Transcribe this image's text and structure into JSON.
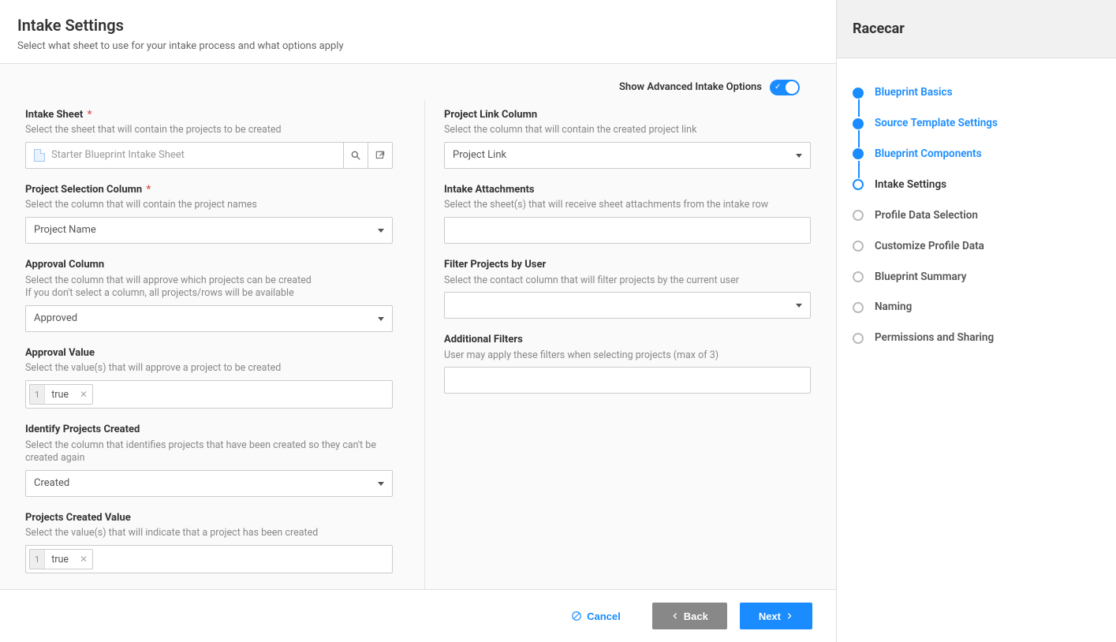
{
  "header": {
    "title": "Intake Settings",
    "subtitle": "Select what sheet to use for your intake process and what options apply"
  },
  "advanced": {
    "label": "Show Advanced Intake Options"
  },
  "left": {
    "intakeSheet": {
      "label": "Intake Sheet",
      "required": true,
      "desc": "Select the sheet that will contain the projects to be created",
      "value": "Starter Blueprint Intake Sheet"
    },
    "projectSelection": {
      "label": "Project Selection Column",
      "required": true,
      "desc": "Select the column that will contain the project names",
      "value": "Project Name"
    },
    "approvalColumn": {
      "label": "Approval Column",
      "desc1": "Select the column that will approve which projects can be created",
      "desc2": "If you don't select a column, all projects/rows will be available",
      "value": "Approved"
    },
    "approvalValue": {
      "label": "Approval Value",
      "desc": "Select the value(s) that will approve a project to be created",
      "tagNum": "1",
      "tagVal": "true"
    },
    "identifyCreated": {
      "label": "Identify Projects Created",
      "desc": "Select the column that identifies projects that have been created so they can't be created again",
      "value": "Created"
    },
    "createdValue": {
      "label": "Projects Created Value",
      "desc": "Select the value(s) that will indicate that a project has been created",
      "tagNum": "1",
      "tagVal": "true"
    }
  },
  "right": {
    "projectLink": {
      "label": "Project Link Column",
      "desc": "Select the column that will contain the created project link",
      "value": "Project Link"
    },
    "intakeAttach": {
      "label": "Intake Attachments",
      "desc": "Select the sheet(s) that will receive sheet attachments from the intake row"
    },
    "filterUser": {
      "label": "Filter Projects by User",
      "desc": "Select the contact column that will filter projects by the current user"
    },
    "additionalFilters": {
      "label": "Additional Filters",
      "desc": "User may apply these filters when selecting projects (max of 3)"
    }
  },
  "footer": {
    "cancel": "Cancel",
    "back": "Back",
    "next": "Next"
  },
  "sidebar": {
    "title": "Racecar",
    "steps": [
      {
        "label": "Blueprint Basics",
        "state": "done"
      },
      {
        "label": "Source Template Settings",
        "state": "done"
      },
      {
        "label": "Blueprint Components",
        "state": "done"
      },
      {
        "label": "Intake Settings",
        "state": "current"
      },
      {
        "label": "Profile Data Selection",
        "state": "todo"
      },
      {
        "label": "Customize Profile Data",
        "state": "todo"
      },
      {
        "label": "Blueprint Summary",
        "state": "todo"
      },
      {
        "label": "Naming",
        "state": "todo"
      },
      {
        "label": "Permissions and Sharing",
        "state": "todo"
      }
    ]
  }
}
